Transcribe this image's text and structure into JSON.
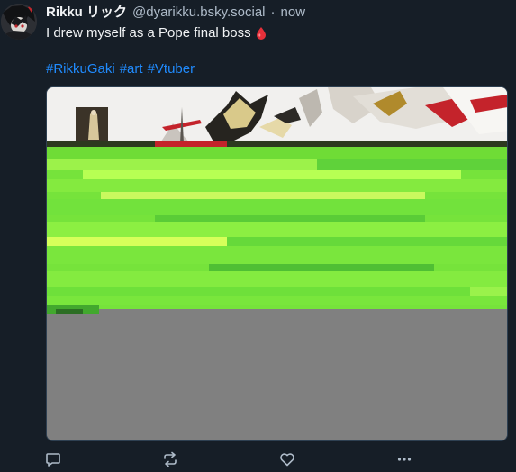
{
  "post": {
    "author": {
      "display_name": "Rikku リック",
      "handle": "@dyarikku.bsky.social",
      "separator": "·",
      "timestamp": "now"
    },
    "text": "I drew myself as a Pope final boss",
    "emoji_icon": "drop-of-blood-icon",
    "hashtags": [
      "#RikkuGaki",
      "#art",
      "#Vtuber"
    ],
    "media": {
      "kind": "image",
      "loaded_fraction": 0.6
    },
    "actions": [
      "reply-icon",
      "repost-icon",
      "like-icon",
      "more-icon"
    ]
  },
  "colors": {
    "background": "#161e27",
    "text": "#f1f3f5",
    "muted": "#aebbc9",
    "link": "#208bfe",
    "drop": "#e5303a",
    "image_placeholder": "#808080",
    "glitch_green": "#7df23a"
  }
}
